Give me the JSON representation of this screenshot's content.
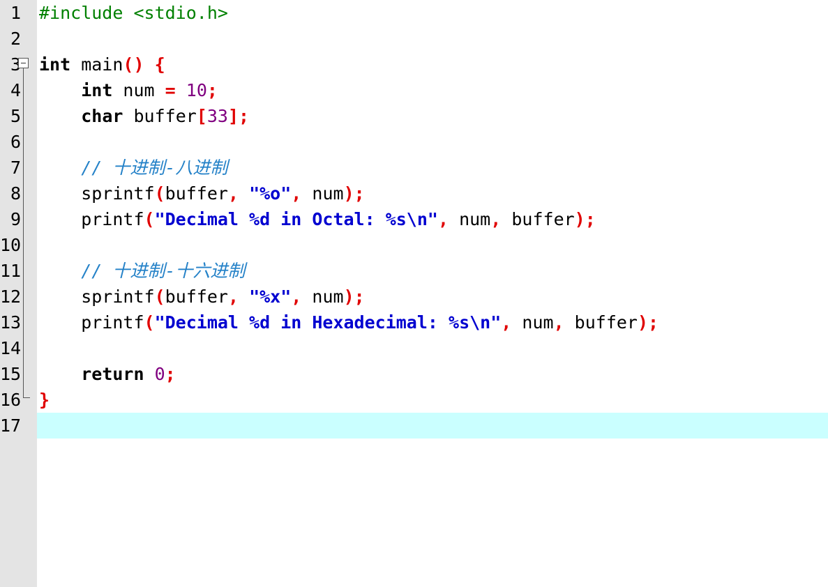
{
  "editor": {
    "current_line": 17,
    "colors": {
      "gutter_bg": "#e4e4e4",
      "current_line_bg": "#caffff",
      "preprocessor": "#008000",
      "keyword": "#000000",
      "operator": "#e00000",
      "number": "#800080",
      "string": "#0000d0",
      "comment": "#2582c8"
    },
    "fold_marker": "minus-box-icon",
    "lines": [
      {
        "num": "1",
        "tokens": [
          {
            "t": "pre",
            "v": "#include <stdio.h>"
          }
        ]
      },
      {
        "num": "2",
        "tokens": []
      },
      {
        "num": "3",
        "tokens": [
          {
            "t": "kw",
            "v": "int"
          },
          {
            "t": "id",
            "v": " main"
          },
          {
            "t": "op",
            "v": "()"
          },
          {
            "t": "id",
            "v": " "
          },
          {
            "t": "op",
            "v": "{"
          }
        ]
      },
      {
        "num": "4",
        "tokens": [
          {
            "t": "id",
            "v": "    "
          },
          {
            "t": "kw",
            "v": "int"
          },
          {
            "t": "id",
            "v": " num "
          },
          {
            "t": "op",
            "v": "="
          },
          {
            "t": "id",
            "v": " "
          },
          {
            "t": "num",
            "v": "10"
          },
          {
            "t": "op",
            "v": ";"
          }
        ]
      },
      {
        "num": "5",
        "tokens": [
          {
            "t": "id",
            "v": "    "
          },
          {
            "t": "kw",
            "v": "char"
          },
          {
            "t": "id",
            "v": " buffer"
          },
          {
            "t": "op",
            "v": "["
          },
          {
            "t": "num",
            "v": "33"
          },
          {
            "t": "op",
            "v": "];"
          }
        ]
      },
      {
        "num": "6",
        "tokens": []
      },
      {
        "num": "7",
        "tokens": [
          {
            "t": "id",
            "v": "    "
          },
          {
            "t": "cmt",
            "v": "// 十进制-八进制"
          }
        ]
      },
      {
        "num": "8",
        "tokens": [
          {
            "t": "id",
            "v": "    sprintf"
          },
          {
            "t": "op",
            "v": "("
          },
          {
            "t": "id",
            "v": "buffer"
          },
          {
            "t": "op",
            "v": ","
          },
          {
            "t": "id",
            "v": " "
          },
          {
            "t": "str",
            "v": "\"%o\""
          },
          {
            "t": "op",
            "v": ","
          },
          {
            "t": "id",
            "v": " num"
          },
          {
            "t": "op",
            "v": ");"
          }
        ]
      },
      {
        "num": "9",
        "tokens": [
          {
            "t": "id",
            "v": "    printf"
          },
          {
            "t": "op",
            "v": "("
          },
          {
            "t": "str",
            "v": "\"Decimal %d in Octal: %s\\n\""
          },
          {
            "t": "op",
            "v": ","
          },
          {
            "t": "id",
            "v": " num"
          },
          {
            "t": "op",
            "v": ","
          },
          {
            "t": "id",
            "v": " buffer"
          },
          {
            "t": "op",
            "v": ");"
          }
        ]
      },
      {
        "num": "10",
        "tokens": []
      },
      {
        "num": "11",
        "tokens": [
          {
            "t": "id",
            "v": "    "
          },
          {
            "t": "cmt",
            "v": "// 十进制-十六进制"
          }
        ]
      },
      {
        "num": "12",
        "tokens": [
          {
            "t": "id",
            "v": "    sprintf"
          },
          {
            "t": "op",
            "v": "("
          },
          {
            "t": "id",
            "v": "buffer"
          },
          {
            "t": "op",
            "v": ","
          },
          {
            "t": "id",
            "v": " "
          },
          {
            "t": "str",
            "v": "\"%x\""
          },
          {
            "t": "op",
            "v": ","
          },
          {
            "t": "id",
            "v": " num"
          },
          {
            "t": "op",
            "v": ");"
          }
        ]
      },
      {
        "num": "13",
        "tokens": [
          {
            "t": "id",
            "v": "    printf"
          },
          {
            "t": "op",
            "v": "("
          },
          {
            "t": "str",
            "v": "\"Decimal %d in Hexadecimal: %s\\n\""
          },
          {
            "t": "op",
            "v": ","
          },
          {
            "t": "id",
            "v": " num"
          },
          {
            "t": "op",
            "v": ","
          },
          {
            "t": "id",
            "v": " buffer"
          },
          {
            "t": "op",
            "v": ");"
          }
        ]
      },
      {
        "num": "14",
        "tokens": []
      },
      {
        "num": "15",
        "tokens": [
          {
            "t": "id",
            "v": "    "
          },
          {
            "t": "kw",
            "v": "return"
          },
          {
            "t": "id",
            "v": " "
          },
          {
            "t": "num",
            "v": "0"
          },
          {
            "t": "op",
            "v": ";"
          }
        ]
      },
      {
        "num": "16",
        "tokens": [
          {
            "t": "op",
            "v": "}"
          }
        ]
      },
      {
        "num": "17",
        "tokens": []
      }
    ]
  }
}
